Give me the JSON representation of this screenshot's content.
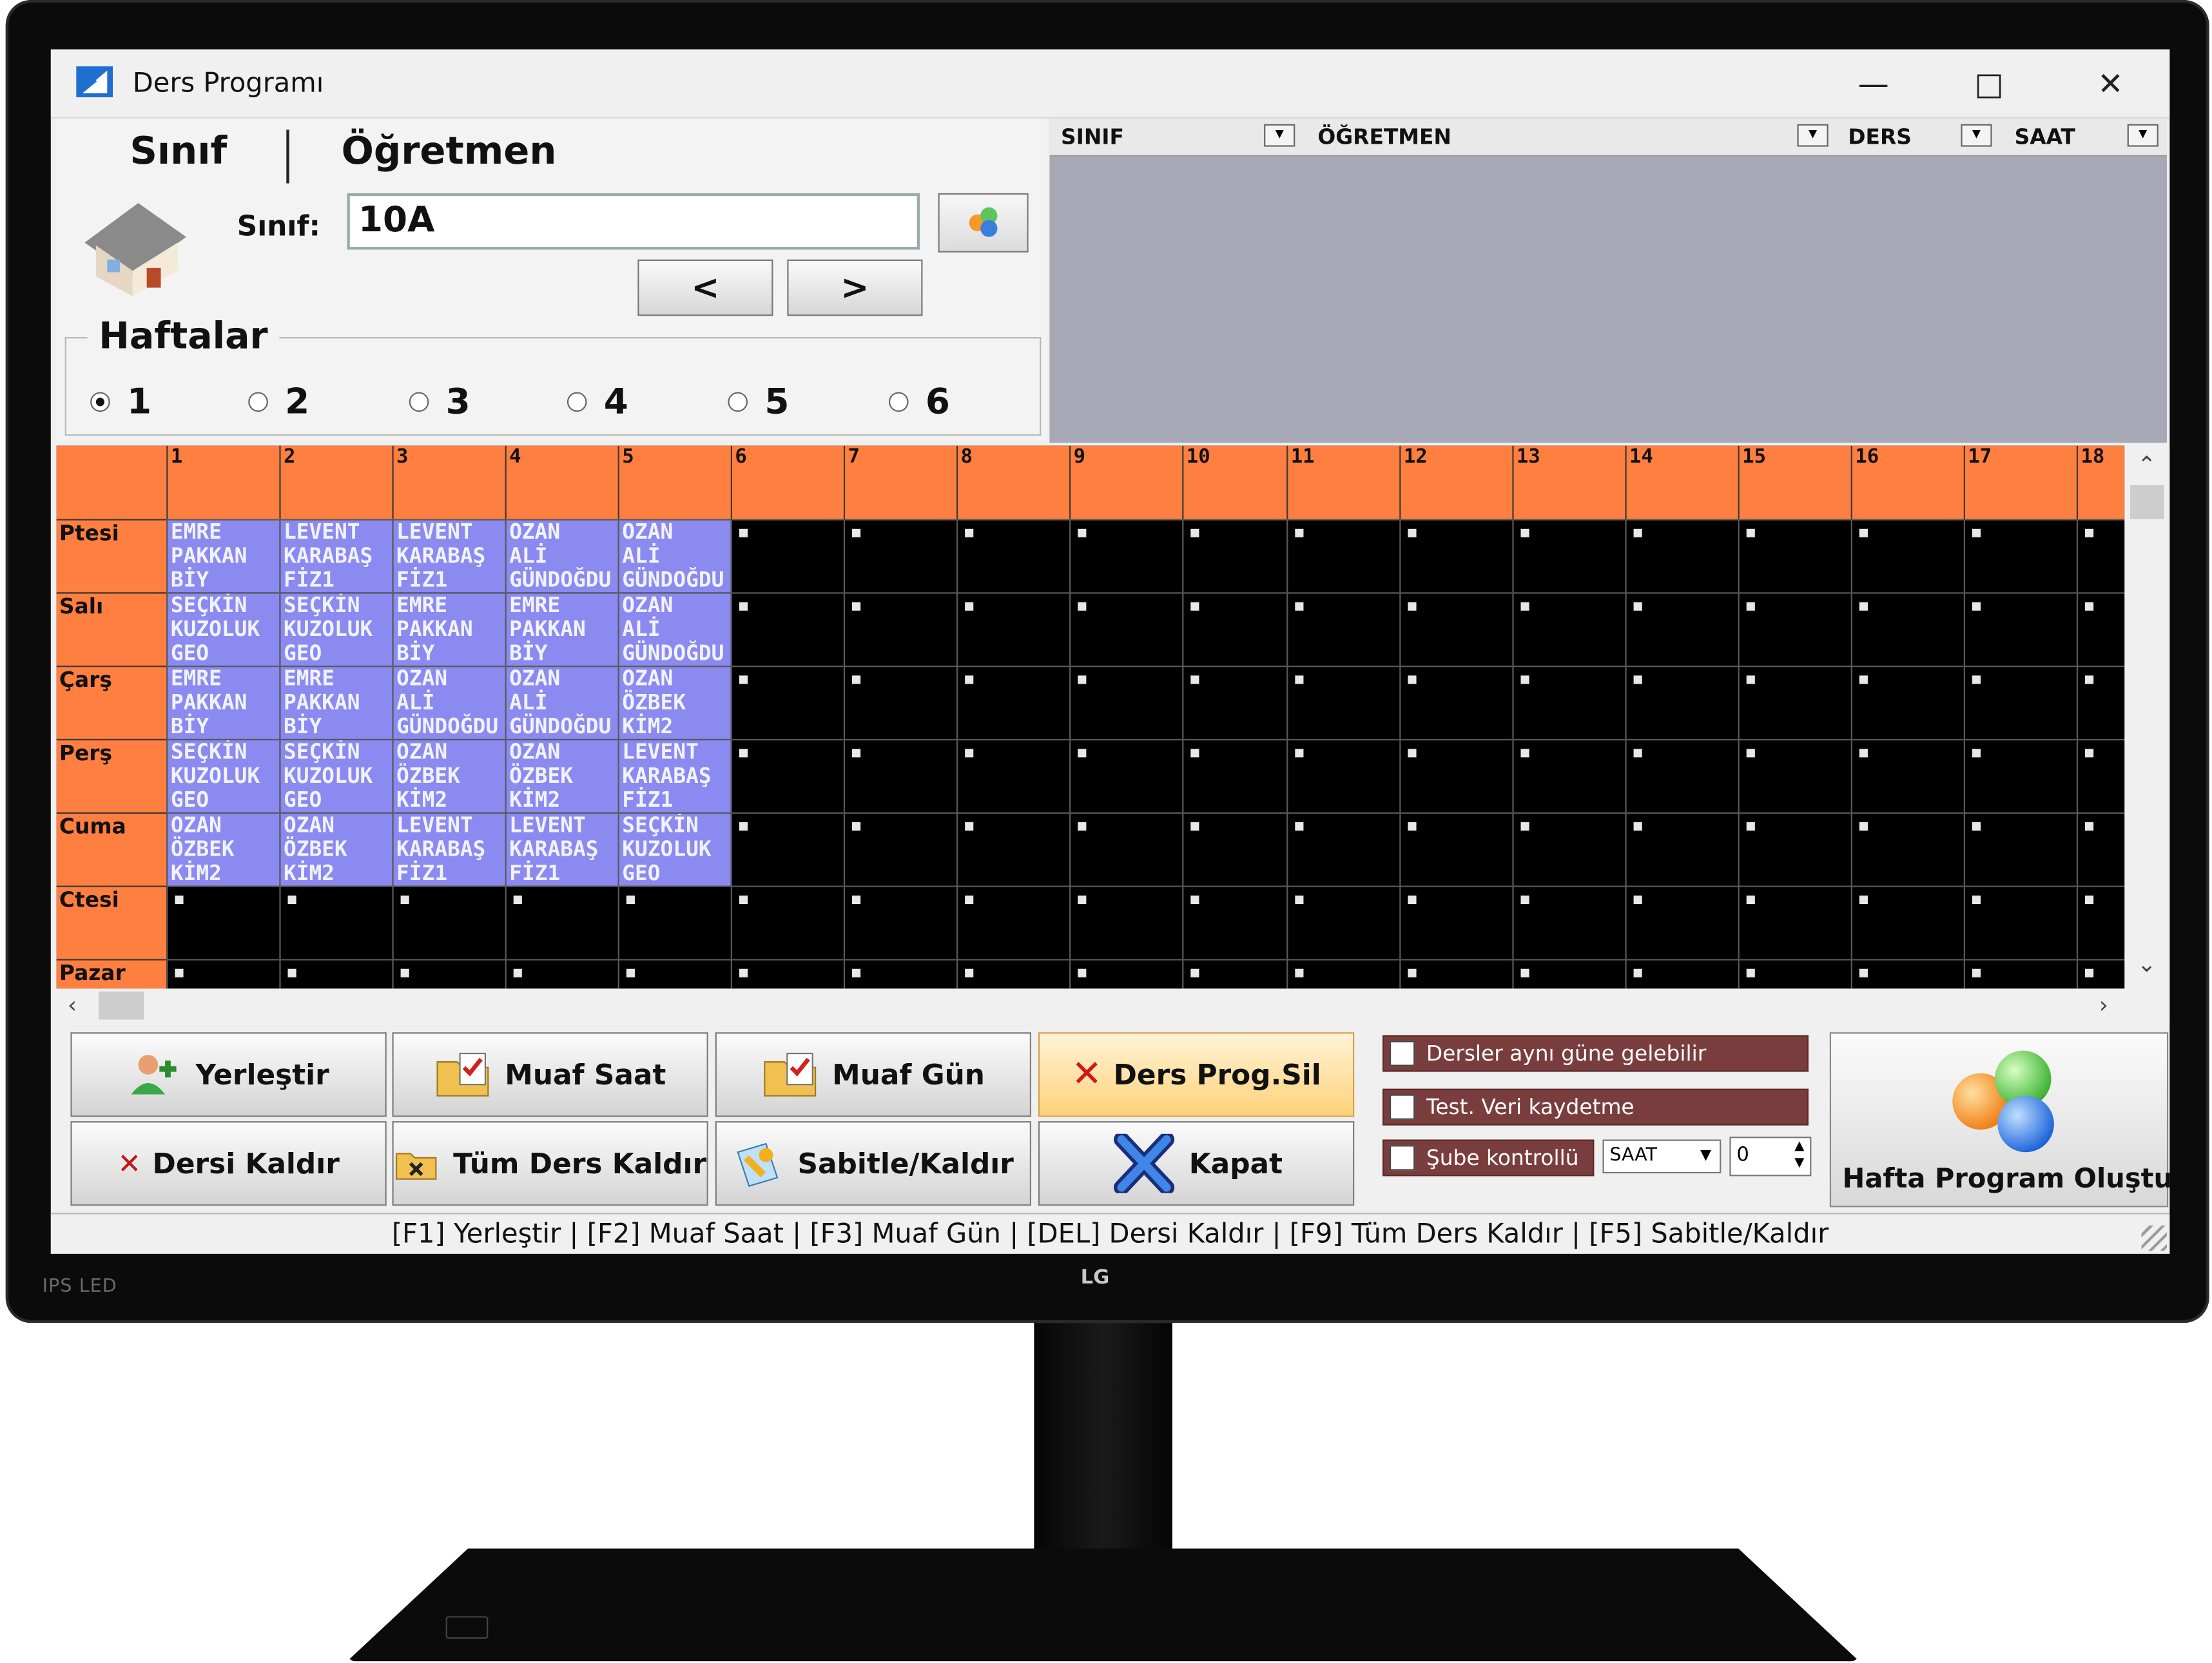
{
  "window": {
    "title": "Ders Programı"
  },
  "tabs": [
    {
      "label": "Sınıf"
    },
    {
      "label": "Öğretmen"
    }
  ],
  "sinif": {
    "label": "Sınıf:",
    "value": "10A",
    "prev_label": "<",
    "next_label": ">"
  },
  "haftalar": {
    "title": "Haftalar",
    "options": [
      "1",
      "2",
      "3",
      "4",
      "5",
      "6"
    ],
    "selected": "1"
  },
  "filter_columns": [
    {
      "label": "SINIF"
    },
    {
      "label": "ÖĞRETMEN"
    },
    {
      "label": "DERS"
    },
    {
      "label": "SAAT"
    }
  ],
  "grid": {
    "hours": [
      "1",
      "2",
      "3",
      "4",
      "5",
      "6",
      "7",
      "8",
      "9",
      "10",
      "11",
      "12",
      "13",
      "14",
      "15",
      "16",
      "17",
      "18"
    ],
    "days": [
      "Ptesi",
      "Salı",
      "Çarş",
      "Perş",
      "Cuma",
      "Ctesi",
      "Pazar"
    ],
    "lessons": [
      [
        [
          "EMRE",
          "PAKKAN",
          "BİY"
        ],
        [
          "LEVENT",
          "KARABAŞ",
          "FİZ1"
        ],
        [
          "LEVENT",
          "KARABAŞ",
          "FİZ1"
        ],
        [
          "OZAN",
          "ALİ",
          "GÜNDOĞDU"
        ],
        [
          "OZAN",
          "ALİ",
          "GÜNDOĞDU"
        ]
      ],
      [
        [
          "SEÇKİN",
          "KUZOLUK",
          "GEO"
        ],
        [
          "SEÇKİN",
          "KUZOLUK",
          "GEO"
        ],
        [
          "EMRE",
          "PAKKAN",
          "BİY"
        ],
        [
          "EMRE",
          "PAKKAN",
          "BİY"
        ],
        [
          "OZAN",
          "ALİ",
          "GÜNDOĞDU"
        ]
      ],
      [
        [
          "EMRE",
          "PAKKAN",
          "BİY"
        ],
        [
          "EMRE",
          "PAKKAN",
          "BİY"
        ],
        [
          "OZAN",
          "ALİ",
          "GÜNDOĞDU"
        ],
        [
          "OZAN",
          "ALİ",
          "GÜNDOĞDU"
        ],
        [
          "OZAN",
          "ÖZBEK",
          "KİM2"
        ]
      ],
      [
        [
          "SEÇKİN",
          "KUZOLUK",
          "GEO"
        ],
        [
          "SEÇKİN",
          "KUZOLUK",
          "GEO"
        ],
        [
          "OZAN",
          "ÖZBEK",
          "KİM2"
        ],
        [
          "OZAN",
          "ÖZBEK",
          "KİM2"
        ],
        [
          "LEVENT",
          "KARABAŞ",
          "FİZ1"
        ]
      ],
      [
        [
          "OZAN",
          "ÖZBEK",
          "KİM2"
        ],
        [
          "OZAN",
          "ÖZBEK",
          "KİM2"
        ],
        [
          "LEVENT",
          "KARABAŞ",
          "FİZ1"
        ],
        [
          "LEVENT",
          "KARABAŞ",
          "FİZ1"
        ],
        [
          "SEÇKİN",
          "KUZOLUK",
          "GEO"
        ]
      ],
      [],
      []
    ]
  },
  "actions": {
    "yerlestir": "Yerleştir",
    "muaf_saat": "Muaf Saat",
    "muaf_gun": "Muaf Gün",
    "ders_prog_sil": "Ders Prog.Sil",
    "dersi_kaldir": "Dersi Kaldır",
    "tum_ders_kaldir": "Tüm Ders Kaldır",
    "sabitle_kaldir": "Sabitle/Kaldır",
    "kapat": "Kapat"
  },
  "options": {
    "ayni_gun": "Dersler aynı güne gelebilir",
    "test_veri": "Test. Veri kaydetme",
    "sube_kontrollu": "Şube kontrollü",
    "saat_select": "SAAT",
    "saat_value": "0"
  },
  "hafta_program_btn": "Hafta Program Oluştur",
  "statusbar": "[F1] Yerleştir  |  [F2]  Muaf Saat  |  [F3]  Muaf Gün  |  [DEL] Dersi Kaldır  |  [F9] Tüm Ders Kaldır  |  [F5] Sabitle/Kaldır",
  "brand": {
    "panel": "IPS LED",
    "logo": "LG"
  },
  "colors": {
    "grid_header": "#ff7f40",
    "lesson_cell": "#8a8af0",
    "empty_cell": "#000000",
    "option_bar": "#7a3d3d"
  }
}
